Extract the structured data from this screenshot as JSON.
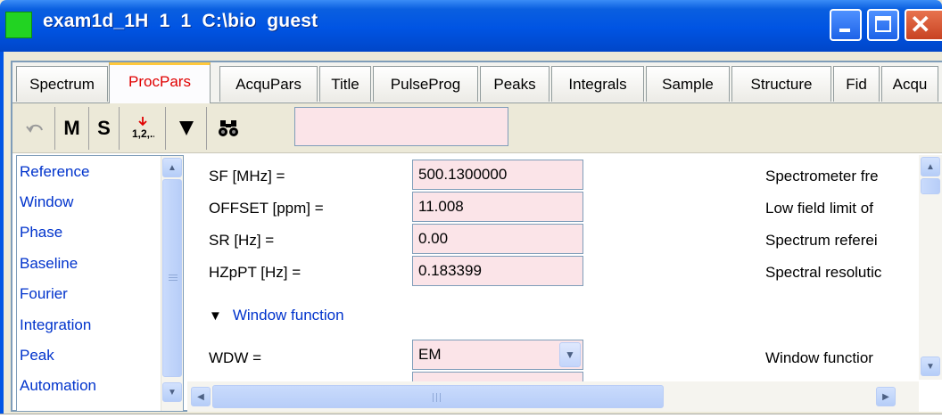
{
  "window": {
    "title": "exam1d_1H  1  1  C:\\bio  guest"
  },
  "tabs": [
    {
      "label": "Spectrum",
      "active": false
    },
    {
      "label": "ProcPars",
      "active": true
    },
    {
      "label": "AcquPars",
      "active": false
    },
    {
      "label": "Title",
      "active": false
    },
    {
      "label": "PulseProg",
      "active": false
    },
    {
      "label": "Peaks",
      "active": false
    },
    {
      "label": "Integrals",
      "active": false
    },
    {
      "label": "Sample",
      "active": false
    },
    {
      "label": "Structure",
      "active": false
    },
    {
      "label": "Fid",
      "active": false
    },
    {
      "label": "Acqu",
      "active": false
    }
  ],
  "toolbar": {
    "undo_icon": "undo-icon",
    "m_label": "M",
    "s_label": "S",
    "sort_icon": "sort-numeric-icon",
    "filter_icon": "filter-triangle-icon",
    "find_icon": "binoculars-icon",
    "search_value": ""
  },
  "nav": {
    "items": [
      "Reference",
      "Window",
      "Phase",
      "Baseline",
      "Fourier",
      "Integration",
      "Peak",
      "Automation"
    ]
  },
  "params": [
    {
      "label": "SF [MHz] =",
      "value": "500.1300000",
      "desc": "Spectrometer fre"
    },
    {
      "label": "OFFSET [ppm] =",
      "value": "11.008",
      "desc": "Low field limit of"
    },
    {
      "label": "SR [Hz] =",
      "value": "0.00",
      "desc": "Spectrum referei"
    },
    {
      "label": "HZpPT [Hz] =",
      "value": "0.183399",
      "desc": "Spectral resolutic"
    }
  ],
  "section": {
    "label": "Window function"
  },
  "wdw": {
    "label": "WDW =",
    "value": "EM",
    "desc": "Window functior"
  },
  "colors": {
    "titlebar": "#0054e3",
    "link": "#0033cc",
    "field_bg": "#fbe4e8",
    "active_tab_text": "#e00000"
  }
}
